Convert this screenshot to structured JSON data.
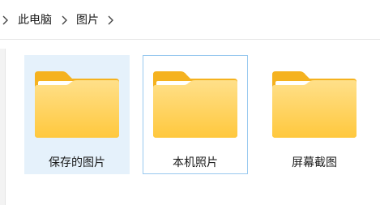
{
  "breadcrumb": {
    "items": [
      {
        "label": "此电脑"
      },
      {
        "label": "图片"
      }
    ]
  },
  "folders": [
    {
      "name": "保存的图片",
      "state": "selected"
    },
    {
      "name": "本机照片",
      "state": "focused"
    },
    {
      "name": "屏幕截图",
      "state": "normal"
    }
  ],
  "colors": {
    "selection_bg": "#e5f1fb",
    "focus_border": "#99c9ef",
    "folder_back": "#f6b92c",
    "folder_front": "#ffd966"
  }
}
